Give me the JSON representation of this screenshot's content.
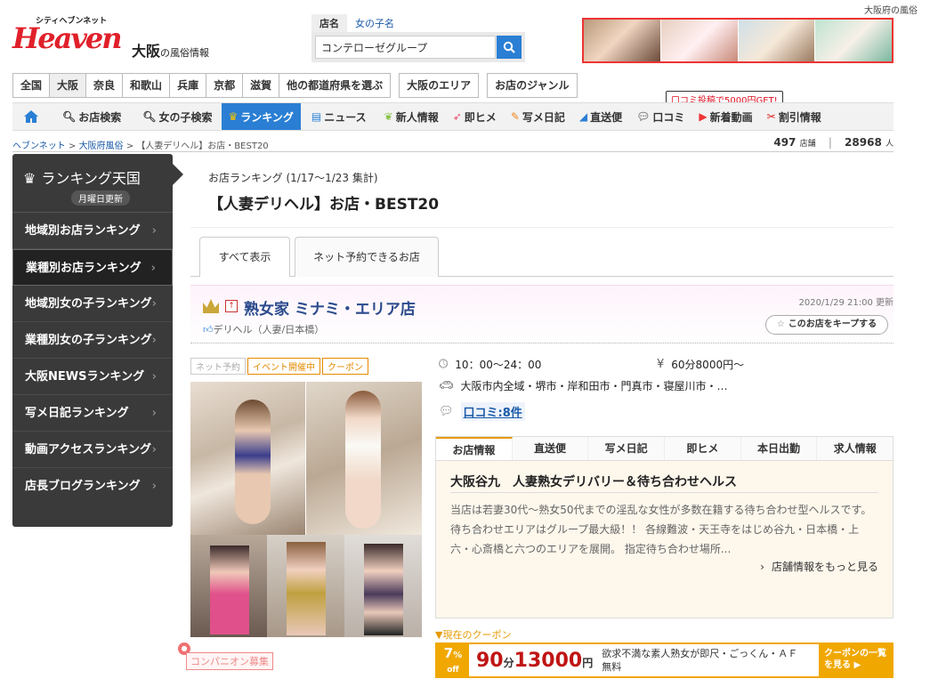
{
  "header": {
    "logo_top": "シティヘブンネット",
    "logo_main": "Heaven",
    "logo_sub": "大阪",
    "logo_sub2": "の風俗情報",
    "region_tag": "大阪府の風俗",
    "search_tabs": [
      "店名",
      "女の子名"
    ],
    "search_value": "コンテローゼグループ"
  },
  "prefectures": [
    "全国",
    "大阪",
    "奈良",
    "和歌山",
    "兵庫",
    "京都",
    "滋賀",
    "他の都道府県を選ぶ"
  ],
  "area_links": [
    "大阪のエリア",
    "お店のジャンル"
  ],
  "nav": {
    "items": [
      "お店検索",
      "女の子検索",
      "ランキング",
      "ニュース",
      "新人情報",
      "即ヒメ",
      "写メ日記",
      "直送便",
      "口コミ",
      "新着動画",
      "割引情報"
    ],
    "tooltip": "口コミ投稿で5000円GET!"
  },
  "breadcrumb": [
    "ヘブンネット",
    "大阪府風俗",
    "【人妻デリヘル】お店・BEST20"
  ],
  "stats": {
    "shops": "497",
    "shops_unit": "店舗",
    "people": "28968",
    "people_unit": "人"
  },
  "sidebar": {
    "title": "ランキング天国",
    "badge": "月曜日更新",
    "items": [
      "地域別お店ランキング",
      "業種別お店ランキング",
      "地域別女の子ランキング",
      "業種別女の子ランキング",
      "大阪NEWSランキング",
      "写メ日記ランキング",
      "動画アクセスランキング",
      "店長ブログランキング"
    ]
  },
  "ranking": {
    "period": "お店ランキング (1/17〜1/23 集計)",
    "title": "【人妻デリヘル】お店・BEST20",
    "tabs": [
      "すべて表示",
      "ネット予約できるお店"
    ]
  },
  "shop": {
    "name": "熟女家 ミナミ・エリア店",
    "genre": "デリヘル（人妻/日本橋）",
    "updated": "2020/1/29 21:00 更新",
    "keep": "このお店をキープする",
    "badges": [
      "ネット予約",
      "イベント開催中",
      "クーポン"
    ],
    "hours": "10：00〜24：00",
    "price": "60分8000円〜",
    "areas": "大阪市内全域・堺市・岸和田市・門真市・寝屋川市・…",
    "reviews": "口コミ:8件",
    "info_tabs": [
      "お店情報",
      "直送便",
      "写メ日記",
      "即ヒメ",
      "本日出勤",
      "求人情報"
    ],
    "catch": "大阪谷九　人妻熟女デリバリー＆待ち合わせヘルス",
    "description": "当店は若妻30代〜熟女50代までの淫乱な女性が多数在籍する待ち合わせ型ヘルスです。待ち合わせエリアはグループ最大級！！ 各線難波・天王寺をはじめ谷九・日本橋・上六・心斎橋と六つのエリアを展開。 指定待ち合わせ場所...",
    "more": "店舗情報をもっと見る"
  },
  "coupon": {
    "label": "▼現在のクーポン",
    "off_num": "7",
    "off_pct": "%",
    "off_word": "off",
    "minutes": "90",
    "minutes_unit": "分",
    "price": "13000",
    "price_unit": "円",
    "desc": "欲求不満な素人熟女が即尺・ごっくん・ＡＦ無料",
    "button": "クーポンの一覧を見る ▶"
  },
  "companion": "コンパニオン募集",
  "colors": {
    "accent": "#2a7fd4",
    "coupon": "#f0a800",
    "price": "#c01515",
    "sidebar": "#3a3a3a"
  }
}
